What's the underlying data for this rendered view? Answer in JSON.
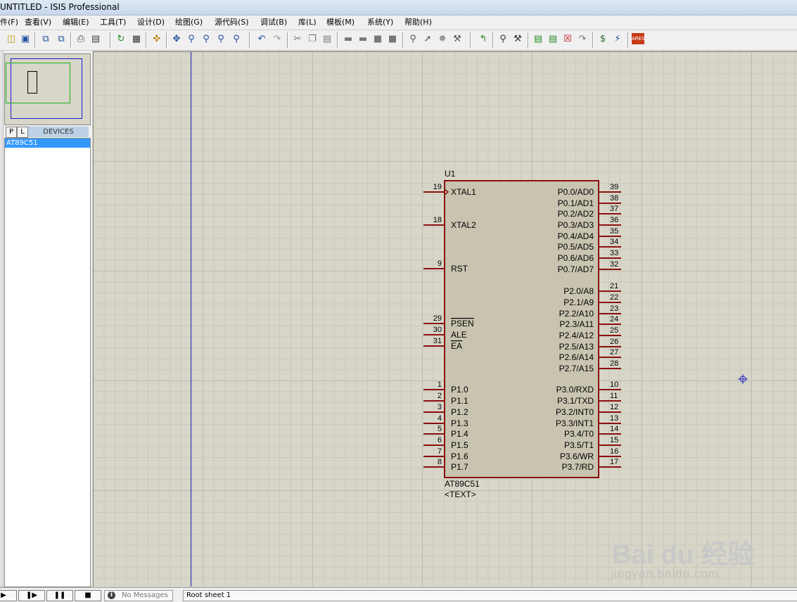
{
  "window": {
    "title": "UNTITLED - ISIS Professional"
  },
  "menu": [
    "件(F)",
    "查看(V)",
    "编辑(E)",
    "工具(T)",
    "设计(D)",
    "绘图(G)",
    "源代码(S)",
    "调试(B)",
    "库(L)",
    "模板(M)",
    "系统(Y)",
    "帮助(H)"
  ],
  "toolbar": {
    "icons": [
      "open-folder-icon",
      "save-icon",
      "import-section-icon",
      "export-section-icon",
      "print-icon",
      "print-area-icon",
      "redraw-icon",
      "grid-toggle-icon",
      "origin-icon",
      "pan-icon",
      "zoom-in-icon",
      "zoom-out-icon",
      "zoom-all-icon",
      "zoom-area-icon",
      "undo-icon",
      "redo-icon",
      "cut-icon",
      "copy-icon",
      "paste-icon",
      "block-copy-icon",
      "block-move-icon",
      "block-rotate-icon",
      "block-delete-icon",
      "pick-device-icon",
      "make-device-icon",
      "packaging-tool-icon",
      "decompose-icon",
      "wire-autorouter-icon",
      "search-tag-icon",
      "property-assignment-tool-icon",
      "new-sheet-icon",
      "add-sheet-icon",
      "remove-sheet-icon",
      "goto-sheet-icon",
      "bill-of-materials-icon",
      "electrical-rules-check-icon",
      "netlist-to-ares-icon"
    ]
  },
  "sidebar": {
    "tab_p": "P",
    "tab_l": "L",
    "devices_title": "DEVICES",
    "devices": [
      {
        "name": "AT89C51",
        "selected": true
      }
    ]
  },
  "schematic": {
    "ref": "U1",
    "part": "AT89C51",
    "text_placeholder": "<TEXT>",
    "left_pins": [
      {
        "num": "19",
        "name": "XTAL1"
      },
      {
        "num": "18",
        "name": "XTAL2"
      },
      {
        "num": "9",
        "name": "RST"
      },
      {
        "num": "29",
        "name": "PSEN"
      },
      {
        "num": "30",
        "name": "ALE"
      },
      {
        "num": "31",
        "name": "EA"
      },
      {
        "num": "1",
        "name": "P1.0"
      },
      {
        "num": "2",
        "name": "P1.1"
      },
      {
        "num": "3",
        "name": "P1.2"
      },
      {
        "num": "4",
        "name": "P1.3"
      },
      {
        "num": "5",
        "name": "P1.4"
      },
      {
        "num": "6",
        "name": "P1.5"
      },
      {
        "num": "7",
        "name": "P1.6"
      },
      {
        "num": "8",
        "name": "P1.7"
      }
    ],
    "right_pins": [
      {
        "num": "39",
        "name": "P0.0/AD0"
      },
      {
        "num": "38",
        "name": "P0.1/AD1"
      },
      {
        "num": "37",
        "name": "P0.2/AD2"
      },
      {
        "num": "36",
        "name": "P0.3/AD3"
      },
      {
        "num": "35",
        "name": "P0.4/AD4"
      },
      {
        "num": "34",
        "name": "P0.5/AD5"
      },
      {
        "num": "33",
        "name": "P0.6/AD6"
      },
      {
        "num": "32",
        "name": "P0.7/AD7"
      },
      {
        "num": "21",
        "name": "P2.0/A8"
      },
      {
        "num": "22",
        "name": "P2.1/A9"
      },
      {
        "num": "23",
        "name": "P2.2/A10"
      },
      {
        "num": "24",
        "name": "P2.3/A11"
      },
      {
        "num": "25",
        "name": "P2.4/A12"
      },
      {
        "num": "26",
        "name": "P2.5/A13"
      },
      {
        "num": "27",
        "name": "P2.6/A14"
      },
      {
        "num": "28",
        "name": "P2.7/A15"
      },
      {
        "num": "10",
        "name": "P3.0/RXD"
      },
      {
        "num": "11",
        "name": "P3.1/TXD"
      },
      {
        "num": "12",
        "name": "P3.2/INT0"
      },
      {
        "num": "13",
        "name": "P3.3/INT1"
      },
      {
        "num": "14",
        "name": "P3.4/T0"
      },
      {
        "num": "15",
        "name": "P3.5/T1"
      },
      {
        "num": "16",
        "name": "P3.6/WR"
      },
      {
        "num": "17",
        "name": "P3.7/RD"
      }
    ]
  },
  "watermark": {
    "logo": "Bai du 经验",
    "url": "jingyan.baidu.com"
  },
  "statusbar": {
    "messages": "No Messages",
    "sheet": "Root sheet 1"
  },
  "colors": {
    "wire": "#8b1010",
    "chip_fill": "#c8c4b0",
    "sheet_edge": "#2020c0",
    "selection": "#3399ff"
  }
}
